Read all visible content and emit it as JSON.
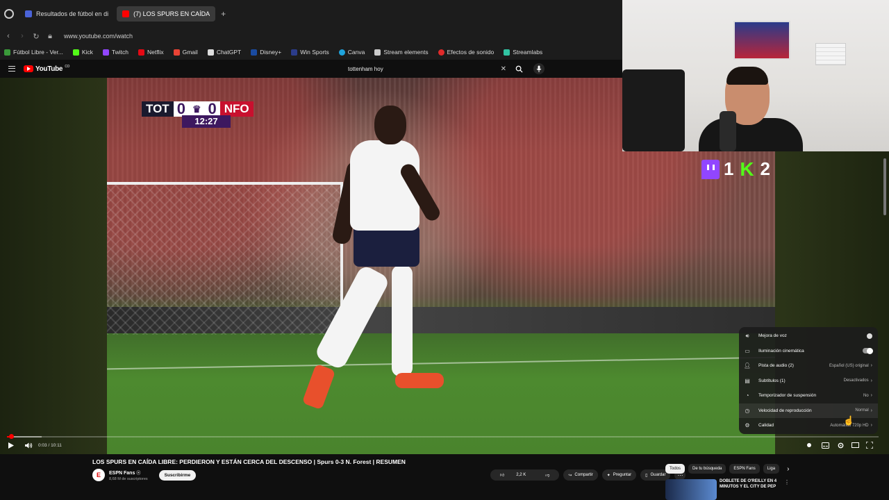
{
  "browser": {
    "tabs": [
      {
        "label": "Resultados de fútbol en di",
        "active": false,
        "favicon_color": "#4a63d8"
      },
      {
        "label": "(7) LOS SPURS EN CAÍDA",
        "active": true,
        "favicon_color": "#ff0000"
      }
    ],
    "new_tab": "+",
    "url": "www.youtube.com/watch",
    "bookmarks": [
      {
        "label": "Fútbol Libre - Ver...",
        "color": "#3a9a3a"
      },
      {
        "label": "Kick",
        "color": "#53fc18"
      },
      {
        "label": "Twitch",
        "color": "#9146ff"
      },
      {
        "label": "Netflix",
        "color": "#e50914"
      },
      {
        "label": "Gmail",
        "color": "#ea4335"
      },
      {
        "label": "ChatGPT",
        "color": "#dddddd"
      },
      {
        "label": "Disney+",
        "color": "#1a4ba0"
      },
      {
        "label": "Win Sports",
        "color": "#2b3c8a"
      },
      {
        "label": "Canva",
        "color": "#1fa3dc"
      },
      {
        "label": "Stream elements",
        "color": "#cccccc"
      },
      {
        "label": "Efectos de sonido",
        "color": "#e02a2a"
      },
      {
        "label": "Streamlabs",
        "color": "#31c3a2"
      }
    ]
  },
  "youtube": {
    "logo_text": "YouTube",
    "country": "CO",
    "search_query": "tottenham hoy"
  },
  "video": {
    "scorebug": {
      "home": "TOT",
      "home_score": "0",
      "away_score": "0",
      "away": "NFO",
      "clock": "12:27"
    },
    "time": "0:03 / 10:11",
    "progress": 0.005,
    "buffered": 0.04
  },
  "stream_counter": {
    "twitch": "1",
    "kick": "2"
  },
  "settings_menu": {
    "items": [
      {
        "label": "Mejora de voz",
        "value": "",
        "control": "dot",
        "icon": "voice-boost-icon"
      },
      {
        "label": "Iluminación cinemática",
        "value": "",
        "control": "toggle-on",
        "icon": "ambient-mode-icon"
      },
      {
        "label": "Pista de audio (2)",
        "value": "Español (US) original",
        "control": "chevron",
        "icon": "audio-track-icon"
      },
      {
        "label": "Subtítulos (1)",
        "value": "Desactivados",
        "control": "chevron",
        "icon": "subtitles-icon"
      },
      {
        "label": "Temporizador de suspensión",
        "value": "No",
        "control": "chevron",
        "icon": "sleep-timer-icon"
      },
      {
        "label": "Velocidad de reproducción",
        "value": "Normal",
        "control": "chevron",
        "icon": "playback-speed-icon"
      },
      {
        "label": "Calidad",
        "value": "Automático 720p HD",
        "control": "chevron",
        "icon": "quality-icon"
      }
    ]
  },
  "video_info": {
    "title": "LOS SPURS EN CAÍDA LIBRE: PERDIERON Y ESTÁN CERCA DEL DESCENSO | Spurs 0-3 N. Forest | RESUMEN",
    "channel": "ESPN Fans",
    "subscribers": "8,68 M de suscriptores",
    "subscribe_label": "Suscribirme",
    "likes": "2,2 K",
    "share": "Compartir",
    "ask": "Preguntar",
    "save": "Guardar"
  },
  "sidebar": {
    "chips": [
      "Todos",
      "De tu búsqueda",
      "ESPN Fans",
      "Liga"
    ],
    "recommended_title": "DOBLETE DE O'REILLY EN 4 MINUTOS Y EL CITY DE PEP"
  },
  "colors": {
    "accent": "#ff0000",
    "twitch": "#9146ff",
    "kick": "#53fc18",
    "premier": "#3d185f"
  }
}
